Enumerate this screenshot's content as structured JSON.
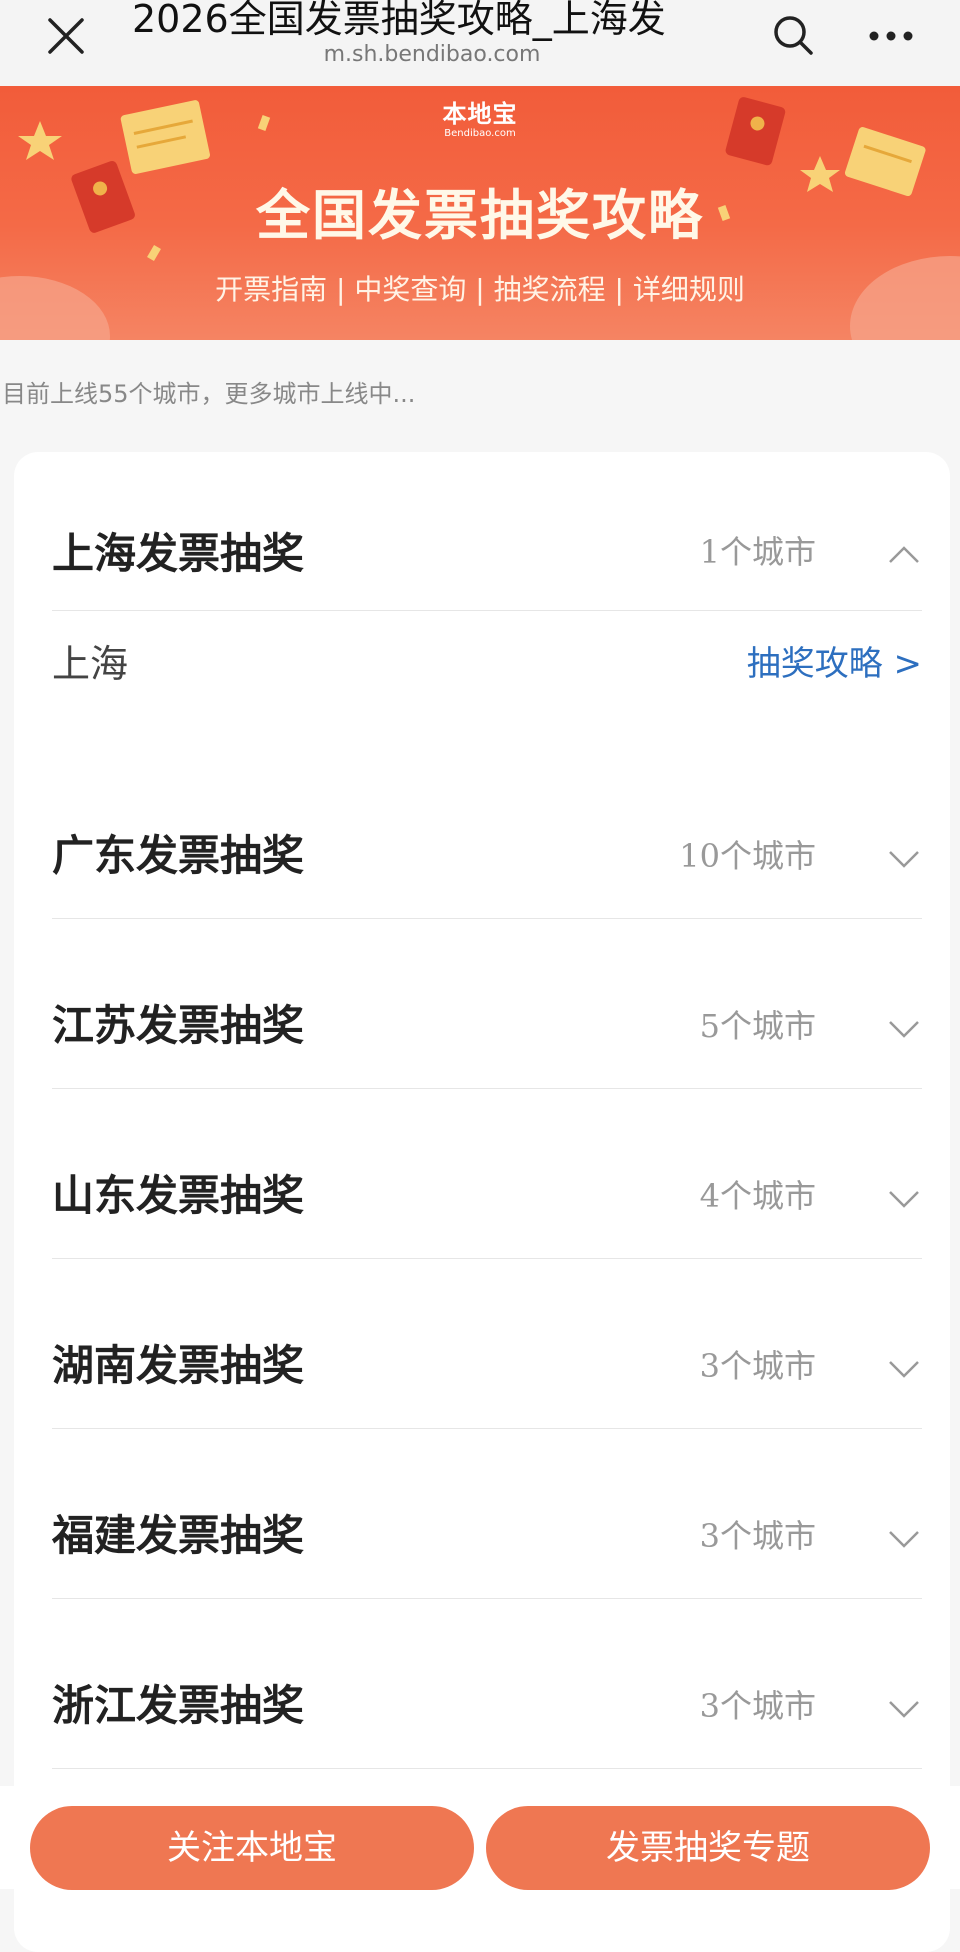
{
  "topbar": {
    "title": "2026全国发票抽奖攻略_上海发",
    "url": "m.sh.bendibao.com"
  },
  "banner": {
    "logo_cn": "本地宝",
    "logo_en": "Bendibao.com",
    "headline": "全国发票抽奖攻略",
    "subline": "开票指南 | 中奖查询 | 抽奖流程 | 详细规则"
  },
  "notice": "目前上线55个城市，更多城市上线中...",
  "groups": [
    {
      "name": "上海发票抽奖",
      "count": "1个城市",
      "expanded": true
    },
    {
      "name": "广东发票抽奖",
      "count": "10个城市",
      "expanded": false
    },
    {
      "name": "江苏发票抽奖",
      "count": "5个城市",
      "expanded": false
    },
    {
      "name": "山东发票抽奖",
      "count": "4个城市",
      "expanded": false
    },
    {
      "name": "湖南发票抽奖",
      "count": "3个城市",
      "expanded": false
    },
    {
      "name": "福建发票抽奖",
      "count": "3个城市",
      "expanded": false
    },
    {
      "name": "浙江发票抽奖",
      "count": "3个城市",
      "expanded": false
    }
  ],
  "city": {
    "name": "上海",
    "link": "抽奖攻略 >"
  },
  "bottom": {
    "follow_label": "关注本地宝",
    "topic_label": "发票抽奖专题"
  },
  "colors": {
    "accent": "#ef7752",
    "link": "#2d6fbf"
  }
}
